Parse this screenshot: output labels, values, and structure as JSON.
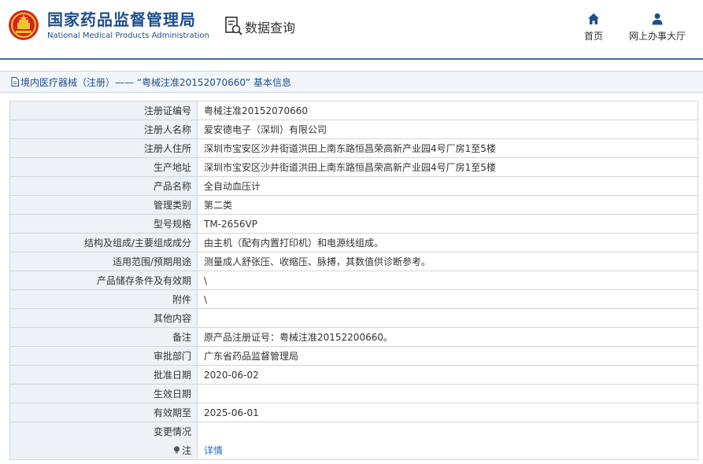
{
  "header": {
    "brand_cn": "国家药品监督管理局",
    "brand_en": "National Medical Products Administration",
    "query_label": "数据查询",
    "nav": [
      {
        "label": "首页",
        "icon": "home-icon"
      },
      {
        "label": "网上办事大厅",
        "icon": "user-icon"
      }
    ],
    "colors": {
      "brand": "#1f4e8c",
      "logo_red": "#d3261b",
      "logo_gold": "#f4c430"
    }
  },
  "breadcrumb": "境内医疗器械（注册）——  “粤械注准20152070660”  基本信息",
  "rows": [
    {
      "label": "注册证编号",
      "value": "粤械注准20152070660"
    },
    {
      "label": "注册人名称",
      "value": "爱安德电子（深圳）有限公司"
    },
    {
      "label": "注册人住所",
      "value": "深圳市宝安区沙井街道洪田上南东路恒昌荣高新产业园4号厂房1至5楼"
    },
    {
      "label": "生产地址",
      "value": "深圳市宝安区沙井街道洪田上南东路恒昌荣高新产业园4号厂房1至5楼"
    },
    {
      "label": "产品名称",
      "value": "全自动血压计"
    },
    {
      "label": "管理类别",
      "value": "第二类"
    },
    {
      "label": "型号规格",
      "value": "TM-2656VP"
    },
    {
      "label": "结构及组成/主要组成成分",
      "value": "由主机（配有内置打印机）和电源线组成。"
    },
    {
      "label": "适用范围/预期用途",
      "value": "测量成人舒张压、收缩压、脉搏，其数值供诊断参考。"
    },
    {
      "label": "产品储存条件及有效期",
      "value": "\\"
    },
    {
      "label": "附件",
      "value": "\\"
    },
    {
      "label": "其他内容",
      "value": ""
    },
    {
      "label": "备注",
      "value": "原产品注册证号：粤械注准20152200660。"
    },
    {
      "label": "审批部门",
      "value": "广东省药品监督管理局"
    },
    {
      "label": "批准日期",
      "value": "2020-06-02"
    },
    {
      "label": "生效日期",
      "value": ""
    },
    {
      "label": "有效期至",
      "value": "2025-06-01"
    },
    {
      "label": "变更情况",
      "value": ""
    }
  ],
  "note_row": {
    "label": "注",
    "icon": "bulb-icon",
    "link": "详情"
  }
}
